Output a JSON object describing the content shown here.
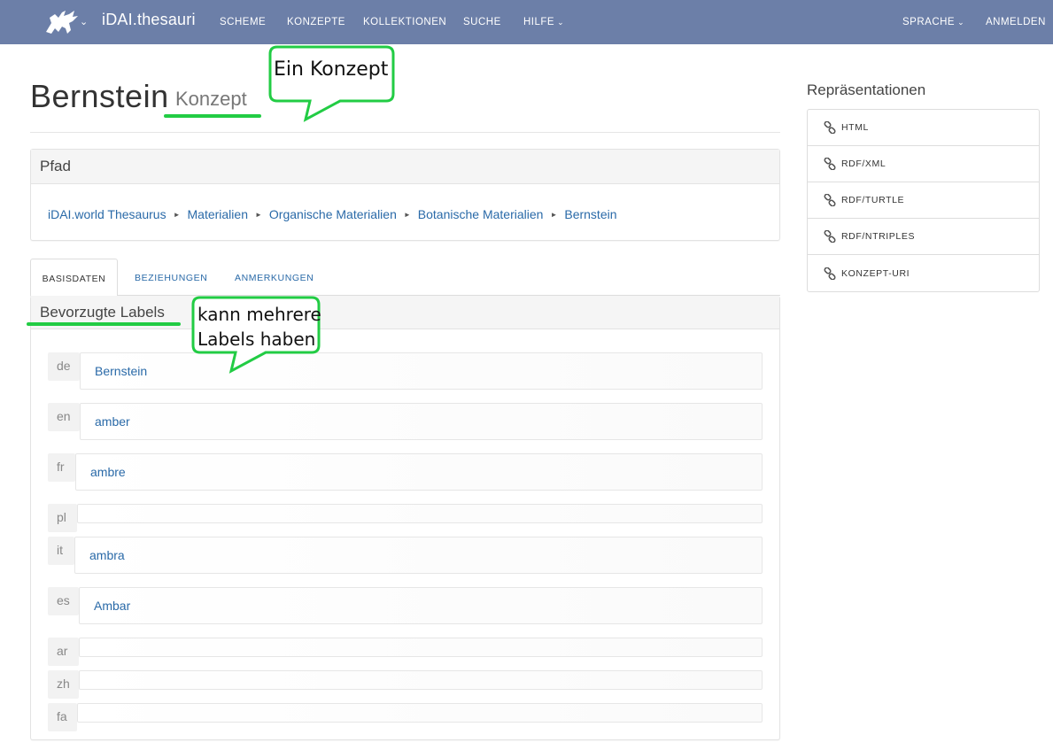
{
  "navbar": {
    "brand": "iDAI.thesauri",
    "items": [
      "SCHEME",
      "KONZEPTE",
      "KOLLEKTIONEN",
      "SUCHE",
      "HILFE"
    ],
    "right_items": [
      "SPRACHE",
      "ANMELDEN"
    ],
    "background": "#6c7fa8"
  },
  "page": {
    "title": "Bernstein",
    "subtitle": "Konzept"
  },
  "pfad": {
    "heading": "Pfad",
    "crumbs": [
      "iDAI.world Thesaurus",
      "Materialien",
      "Organische Materialien",
      "Botanische Materialien",
      "Bernstein"
    ]
  },
  "tabs": [
    "BASISDATEN",
    "BEZIEHUNGEN",
    "ANMERKUNGEN"
  ],
  "labels": {
    "heading": "Bevorzugte Labels",
    "rows": [
      {
        "lang": "de",
        "value": "Bernstein"
      },
      {
        "lang": "en",
        "value": "amber"
      },
      {
        "lang": "fr",
        "value": "ambre"
      },
      {
        "lang": "pl",
        "value": ""
      },
      {
        "lang": "it",
        "value": "ambra"
      },
      {
        "lang": "es",
        "value": "Ambar"
      },
      {
        "lang": "ar",
        "value": ""
      },
      {
        "lang": "zh",
        "value": ""
      },
      {
        "lang": "fa",
        "value": ""
      }
    ]
  },
  "sidebar": {
    "title": "Repräsentationen",
    "items": [
      "HTML",
      "RDF/XML",
      "RDF/TURTLE",
      "RDF/NTRIPLES",
      "KONZEPT-URI"
    ]
  },
  "annotations": {
    "callout1": "Ein Konzept",
    "callout2_line1": "kann mehrere",
    "callout2_line2": "Labels haben",
    "color": "#22cc44"
  },
  "icons": {
    "logo": "griffin-logo-icon",
    "link": "link-icon",
    "caret": "chevron-down-icon"
  }
}
